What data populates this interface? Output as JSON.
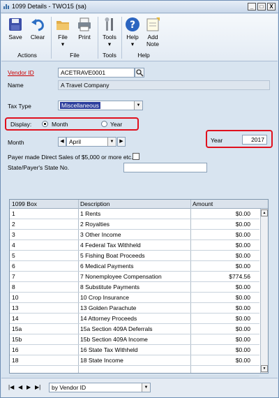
{
  "window": {
    "title": "1099 Details  -  TWO15 (sa)",
    "minimize": "_",
    "restore": "□",
    "close": "X"
  },
  "ribbon": {
    "buttons": [
      {
        "label": "Save",
        "icon": "save-icon"
      },
      {
        "label": "Clear",
        "icon": "undo-icon"
      },
      {
        "label": "File",
        "icon": "folder-icon"
      },
      {
        "label": "Print",
        "icon": "printer-icon"
      },
      {
        "label": "Tools",
        "icon": "tools-icon"
      },
      {
        "label": "Help",
        "icon": "help-icon"
      },
      {
        "label": "Add Note",
        "icon": "note-icon"
      }
    ],
    "groups": [
      "Actions",
      "File",
      "Tools",
      "Help"
    ]
  },
  "form": {
    "vendor_id_label": "Vendor ID",
    "vendor_id_value": "ACETRAVE0001",
    "name_label": "Name",
    "name_value": "A Travel Company",
    "tax_type_label": "Tax Type",
    "tax_type_value": "Miscellaneous",
    "display_label": "Display:",
    "display_month": "Month",
    "display_year": "Year",
    "display_selected": "Month",
    "month_label": "Month",
    "month_value": "April",
    "year_label": "Year",
    "year_value": "2017",
    "direct_sales_label": "Payer made Direct Sales of $5,000 or more etc.",
    "state_no_label": "State/Payer's State No.",
    "state_no_value": ""
  },
  "table": {
    "headers": [
      "1099 Box",
      "Description",
      "Amount"
    ],
    "rows": [
      [
        "1",
        "1 Rents",
        "$0.00"
      ],
      [
        "2",
        "2 Royalties",
        "$0.00"
      ],
      [
        "3",
        "3 Other Income",
        "$0.00"
      ],
      [
        "4",
        "4 Federal Tax Withheld",
        "$0.00"
      ],
      [
        "5",
        "5 Fishing Boat Proceeds",
        "$0.00"
      ],
      [
        "6",
        "6 Medical Payments",
        "$0.00"
      ],
      [
        "7",
        "7 Nonemployee Compensation",
        "$774.56"
      ],
      [
        "8",
        "8 Substitute Payments",
        "$0.00"
      ],
      [
        "10",
        "10 Crop Insurance",
        "$0.00"
      ],
      [
        "13",
        "13 Golden Parachute",
        "$0.00"
      ],
      [
        "14",
        "14 Attorney Proceeds",
        "$0.00"
      ],
      [
        "15a",
        "15a Section 409A Deferrals",
        "$0.00"
      ],
      [
        "15b",
        "15b Section 409A Income",
        "$0.00"
      ],
      [
        "16",
        "16 State Tax Withheld",
        "$0.00"
      ],
      [
        "18",
        "18 State Income",
        "$0.00"
      ],
      [
        "",
        "",
        ""
      ]
    ]
  },
  "navigation": {
    "sort_label": "by Vendor ID"
  },
  "colors": {
    "highlight": "#e0101e",
    "window_bg": "#d8e4f0",
    "selected_field": "#2b3d9c"
  }
}
